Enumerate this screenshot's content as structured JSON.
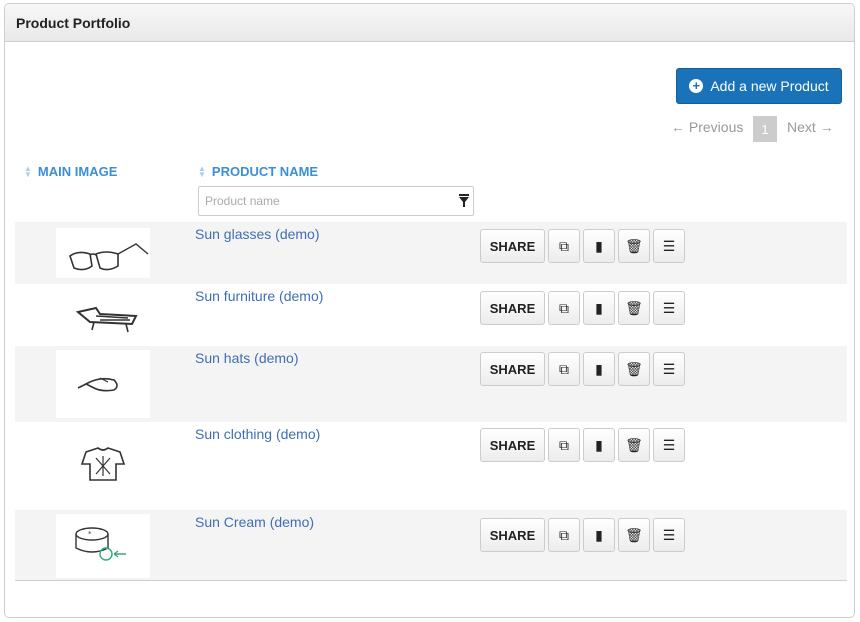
{
  "panel": {
    "title": "Product Portfolio"
  },
  "toolbar": {
    "add_label": "Add a new Product"
  },
  "pagination": {
    "previous": "← Previous",
    "current": "1",
    "next": "Next →"
  },
  "table": {
    "columns": [
      "MAIN IMAGE",
      "PRODUCT NAME"
    ],
    "filter_placeholder": "Product name",
    "share_label": "SHARE",
    "rows": [
      {
        "name": "Sun glasses (demo)",
        "image": "sunglasses-sketch"
      },
      {
        "name": "Sun furniture (demo)",
        "image": "sun-lounger-sketch"
      },
      {
        "name": "Sun hats (demo)",
        "image": "cap-sketch"
      },
      {
        "name": "Sun clothing (demo)",
        "image": "tshirt-sketch"
      },
      {
        "name": "Sun Cream (demo)",
        "image": "cream-jar-sketch"
      }
    ]
  },
  "colors": {
    "accent": "#1a73b8",
    "link": "#3f6eb5",
    "header_text": "#3a8fd6"
  }
}
